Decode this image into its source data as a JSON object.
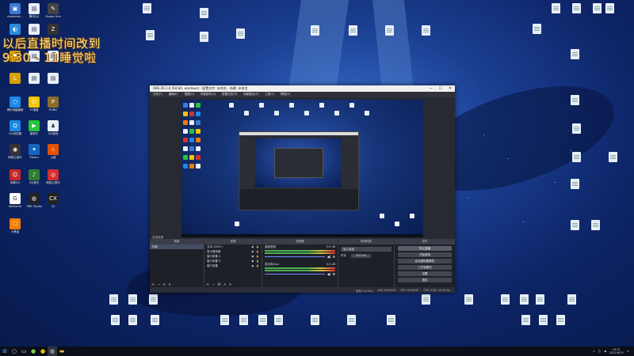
{
  "overlay": {
    "line1": "以后直播时间改到",
    "line2": "9:30 - 11睡觉啦"
  },
  "desktop_icons_left": [
    {
      "label": "Administr...",
      "color": "#3a7bd5",
      "glyph": "▣"
    },
    {
      "label": "腾讯QQ",
      "color": "#e8eef8",
      "glyph": "▤"
    },
    {
      "label": "Studio One",
      "color": "#444",
      "glyph": "✎"
    },
    {
      "label": "",
      "color": "#2a8be0",
      "glyph": "◐"
    },
    {
      "label": "",
      "color": "#e8eef8",
      "glyph": "▤"
    },
    {
      "label": "",
      "color": "#333",
      "glyph": "Z"
    },
    {
      "label": "",
      "color": "#d8a000",
      "glyph": "⚑"
    },
    {
      "label": "",
      "color": "#e8eef8",
      "glyph": "▤"
    },
    {
      "label": "",
      "color": "#e8eef8",
      "glyph": "▤"
    },
    {
      "label": "",
      "color": "#d8a000",
      "glyph": "L"
    },
    {
      "label": "",
      "color": "#e8eef8",
      "glyph": "▤"
    },
    {
      "label": "",
      "color": "#e8eef8",
      "glyph": "▤"
    },
    {
      "label": "腾讯电脑管家",
      "color": "#1e88e5",
      "glyph": "⬡"
    },
    {
      "label": "YY语音",
      "color": "#f2c400",
      "glyph": "☺"
    },
    {
      "label": "PUBG",
      "color": "#8a6d2a",
      "glyph": "P"
    },
    {
      "label": "QQ浏览器",
      "color": "#1e88e5",
      "glyph": "Q"
    },
    {
      "label": "爱奇艺",
      "color": "#26c43a",
      "glyph": "▶"
    },
    {
      "label": "QQ游戏",
      "color": "#e8eef8",
      "glyph": "♟"
    },
    {
      "label": "网易云音乐",
      "color": "#333",
      "glyph": "◉"
    },
    {
      "label": "Steam",
      "color": "#1565c0",
      "glyph": "✦"
    },
    {
      "label": "火绒",
      "color": "#e65100",
      "glyph": "♨"
    },
    {
      "label": "网易UU",
      "color": "#c62828",
      "glyph": "☺"
    },
    {
      "label": "QQ音乐",
      "color": "#2e7d32",
      "glyph": "♪"
    },
    {
      "label": "网易云音乐",
      "color": "#d32f2f",
      "glyph": "◎"
    },
    {
      "label": "WeGame",
      "color": "#fafafa",
      "glyph": "G"
    },
    {
      "label": "OBS Studio",
      "color": "#222",
      "glyph": "◍"
    },
    {
      "label": "CX",
      "color": "#222",
      "glyph": "CX"
    },
    {
      "label": "小黑盒",
      "color": "#f57c00",
      "glyph": "☐"
    }
  ],
  "obs": {
    "title": "OBS 26.1.0 (64-bit, windows) - 配置文件: 未命名 - 场景: 未命名",
    "menu": [
      "文件(F)",
      "编辑(E)",
      "视图(V)",
      "停靠部件(D)",
      "配置文件(P)",
      "场景集合(S)",
      "工具(T)",
      "帮助(H)"
    ],
    "no_source": "未选择源",
    "docks": {
      "scenes": "场景",
      "sources": "来源",
      "mixer": "混音器",
      "transitions": "转场特效",
      "controls": "控件"
    },
    "scenes": [
      "场景"
    ],
    "sources": [
      "文本 (GDI+)",
      "显示器采集",
      "窗口采集 2",
      "窗口采集 3",
      "窗口采集"
    ],
    "mixer": [
      {
        "name": "桌面音频",
        "db": "0.0 dB"
      },
      {
        "name": "麦克风/Aux",
        "db": "0.0 dB"
      }
    ],
    "transition": {
      "type": "淡入淡出",
      "duration_label": "时长",
      "duration": "300 ms"
    },
    "controls": [
      "停止直播",
      "开始录制",
      "启动虚拟摄像机",
      "工作室模式",
      "设置",
      "退出"
    ],
    "status": [
      "丢帧 0 (0.0%)",
      "LIVE: 00:00:00",
      "REC: 00:00:00",
      "CPU: 4.8%, 30.00 fps"
    ]
  },
  "taskbar": {
    "time": "19:31",
    "date": "2021/6/15"
  }
}
